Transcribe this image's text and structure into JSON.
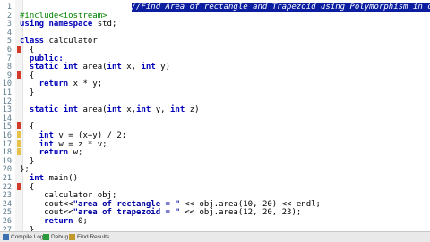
{
  "editor": {
    "lines": [
      {
        "n": "1",
        "fold": "",
        "segs": [
          {
            "c": "                       "
          },
          {
            "c": "//Find Area of rectangle and Trapezoid using Polymorphism in cpp",
            "t": "cmt"
          }
        ]
      },
      {
        "n": "2",
        "fold": "",
        "segs": [
          {
            "c": "#include<iostream>",
            "t": "pp"
          }
        ]
      },
      {
        "n": "3",
        "fold": "",
        "segs": [
          {
            "c": "using namespace",
            "t": "kw"
          },
          {
            "c": " std;"
          }
        ]
      },
      {
        "n": "4",
        "fold": "",
        "segs": []
      },
      {
        "n": "5",
        "fold": "",
        "segs": [
          {
            "c": "class",
            "t": "kw"
          },
          {
            "c": " calculator"
          }
        ]
      },
      {
        "n": "6",
        "fold": "red",
        "segs": [
          {
            "c": "  {"
          }
        ]
      },
      {
        "n": "7",
        "fold": "",
        "segs": [
          {
            "c": "  public:",
            "t": "kw"
          }
        ]
      },
      {
        "n": "8",
        "fold": "",
        "segs": [
          {
            "c": "  static int",
            "t": "kw"
          },
          {
            "c": " area("
          },
          {
            "c": "int",
            "t": "kw"
          },
          {
            "c": " x, "
          },
          {
            "c": "int",
            "t": "kw"
          },
          {
            "c": " y)"
          }
        ]
      },
      {
        "n": "9",
        "fold": "red",
        "segs": [
          {
            "c": "  {"
          }
        ]
      },
      {
        "n": "10",
        "fold": "",
        "segs": [
          {
            "c": "    return",
            "t": "kw"
          },
          {
            "c": " x * y;"
          }
        ]
      },
      {
        "n": "11",
        "fold": "",
        "segs": [
          {
            "c": "  }"
          }
        ]
      },
      {
        "n": "12",
        "fold": "",
        "segs": []
      },
      {
        "n": "13",
        "fold": "",
        "segs": [
          {
            "c": "  static int",
            "t": "kw"
          },
          {
            "c": " area("
          },
          {
            "c": "int",
            "t": "kw"
          },
          {
            "c": " x,"
          },
          {
            "c": "int",
            "t": "kw"
          },
          {
            "c": " y, "
          },
          {
            "c": "int",
            "t": "kw"
          },
          {
            "c": " z)"
          }
        ]
      },
      {
        "n": "14",
        "fold": "",
        "segs": []
      },
      {
        "n": "15",
        "fold": "red",
        "segs": [
          {
            "c": "  {"
          }
        ]
      },
      {
        "n": "16",
        "fold": "yellow",
        "segs": [
          {
            "c": "    int",
            "t": "kw"
          },
          {
            "c": " v = (x+y) / 2;"
          }
        ]
      },
      {
        "n": "17",
        "fold": "yellow",
        "segs": [
          {
            "c": "    int",
            "t": "kw"
          },
          {
            "c": " w = z * v;"
          }
        ]
      },
      {
        "n": "18",
        "fold": "yellow",
        "segs": [
          {
            "c": "    return",
            "t": "kw"
          },
          {
            "c": " w;"
          }
        ]
      },
      {
        "n": "19",
        "fold": "",
        "segs": [
          {
            "c": "  }"
          }
        ]
      },
      {
        "n": "20",
        "fold": "",
        "segs": [
          {
            "c": "};"
          }
        ]
      },
      {
        "n": "21",
        "fold": "",
        "segs": [
          {
            "c": "  int",
            "t": "kw"
          },
          {
            "c": " main()"
          }
        ]
      },
      {
        "n": "22",
        "fold": "red",
        "segs": [
          {
            "c": "  {"
          }
        ]
      },
      {
        "n": "23",
        "fold": "",
        "segs": [
          {
            "c": "     calculator obj;"
          }
        ]
      },
      {
        "n": "24",
        "fold": "",
        "segs": [
          {
            "c": "     cout<<"
          },
          {
            "c": "\"area of rectangle = \"",
            "t": "str"
          },
          {
            "c": " << obj.area(10, 20) << endl;"
          }
        ]
      },
      {
        "n": "25",
        "fold": "",
        "segs": [
          {
            "c": "     cout<<"
          },
          {
            "c": "\"area of trapezoid = \"",
            "t": "str"
          },
          {
            "c": " << obj.area(12, 20, 23);"
          }
        ]
      },
      {
        "n": "26",
        "fold": "",
        "segs": [
          {
            "c": "     return",
            "t": "kw"
          },
          {
            "c": " 0;"
          }
        ]
      },
      {
        "n": "27",
        "fold": "",
        "segs": [
          {
            "c": "  }"
          }
        ]
      }
    ]
  },
  "statusbar": {
    "tabs": [
      {
        "label": "Compile Log",
        "icon": "compile-log-icon",
        "color": "#3b6fb0"
      },
      {
        "label": "Debug",
        "icon": "debug-icon",
        "color": "#2a9a3a"
      },
      {
        "label": "Find Results",
        "icon": "find-results-icon",
        "color": "#c09a2a"
      }
    ]
  }
}
